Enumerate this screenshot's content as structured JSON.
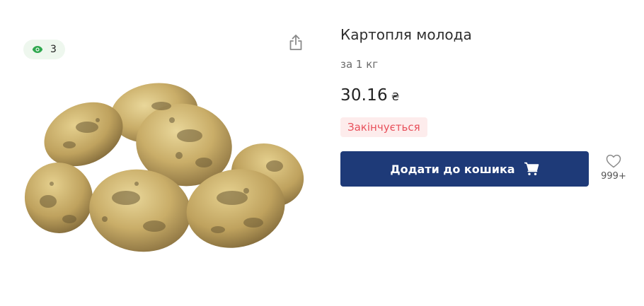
{
  "views": {
    "icon": "eye-icon",
    "count": "3",
    "accent": "#2fa84f"
  },
  "share": {
    "icon": "share-icon"
  },
  "product": {
    "image": "potatoes-image",
    "title": "Картопля молода",
    "unit": "за 1 кг",
    "price": "30.16",
    "currency": "₴",
    "stock_status": "Закінчується",
    "stock_color": "#e8505b"
  },
  "actions": {
    "add_to_cart_label": "Додати до кошика",
    "cart_icon": "cart-icon",
    "button_color": "#1e3a78",
    "wishlist_icon": "heart-icon",
    "wishlist_count": "999+"
  }
}
